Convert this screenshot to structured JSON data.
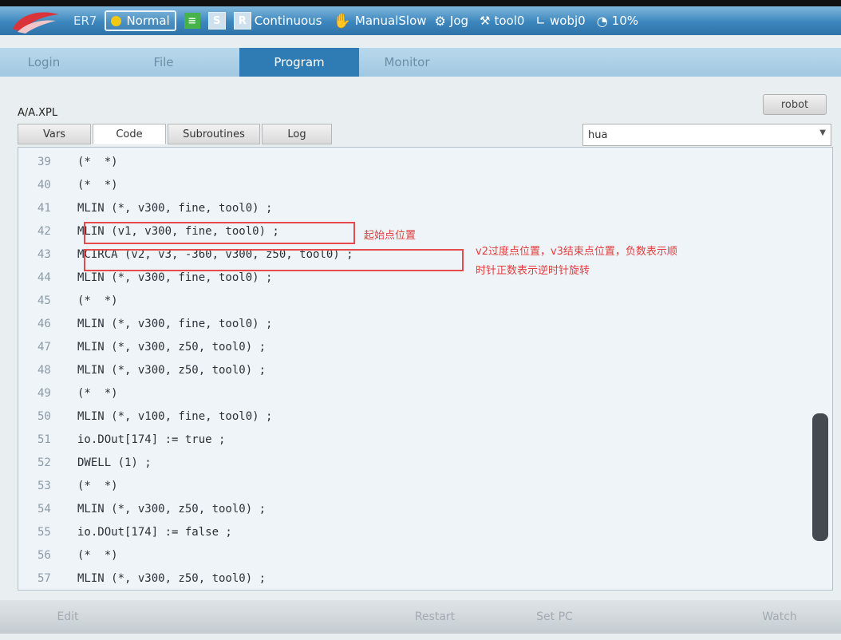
{
  "topbar": {
    "robot_model": "ER7",
    "mode": "Normal",
    "s_label": "S",
    "r_label": "R",
    "run_mode": "Continuous",
    "speed_mode": "ManualSlow",
    "jog": "Jog",
    "tool": "tool0",
    "wobj": "wobj0",
    "override": "10%"
  },
  "menu": {
    "login": "Login",
    "file": "File",
    "program": "Program",
    "monitor": "Monitor"
  },
  "path": "A/A.XPL",
  "robot_button": "robot",
  "subtabs": {
    "vars": "Vars",
    "code": "Code",
    "subroutines": "Subroutines",
    "log": "Log"
  },
  "routine_select": "hua",
  "code_lines": [
    {
      "num": "39",
      "text": "(*  *)"
    },
    {
      "num": "40",
      "text": "(*  *)"
    },
    {
      "num": "41",
      "text": "MLIN (*, v300, fine, tool0) ;"
    },
    {
      "num": "42",
      "text": "MLIN (v1, v300, fine, tool0) ;"
    },
    {
      "num": "43",
      "text": "MCIRCA (v2, v3, -360, v300, z50, tool0) ;"
    },
    {
      "num": "44",
      "text": "MLIN (*, v300, fine, tool0) ;"
    },
    {
      "num": "45",
      "text": "(*  *)"
    },
    {
      "num": "46",
      "text": "MLIN (*, v300, fine, tool0) ;"
    },
    {
      "num": "47",
      "text": "MLIN (*, v300, z50, tool0) ;"
    },
    {
      "num": "48",
      "text": "MLIN (*, v300, z50, tool0) ;"
    },
    {
      "num": "49",
      "text": "(*  *)"
    },
    {
      "num": "50",
      "text": "MLIN (*, v100, fine, tool0) ;"
    },
    {
      "num": "51",
      "text": "io.DOut[174] := true ;"
    },
    {
      "num": "52",
      "text": "DWELL (1) ;"
    },
    {
      "num": "53",
      "text": "(*  *)"
    },
    {
      "num": "54",
      "text": "MLIN (*, v300, z50, tool0) ;"
    },
    {
      "num": "55",
      "text": "io.DOut[174] := false ;"
    },
    {
      "num": "56",
      "text": "(*  *)"
    },
    {
      "num": "57",
      "text": "MLIN (*, v300, z50, tool0) ;"
    }
  ],
  "annotations": {
    "start_note": "起始点位置",
    "circle_note_line1": "v2过度点位置，v3结束点位置，负数表示顺",
    "circle_note_line2": "时针正数表示逆时针旋转"
  },
  "bottombar": {
    "edit": "Edit",
    "restart": "Restart",
    "set_pc": "Set PC",
    "watch": "Watch"
  },
  "colors": {
    "topbar_blue": "#3c86bd",
    "active_tab": "#2f7bb4",
    "annotation_red": "#e33c3c"
  }
}
